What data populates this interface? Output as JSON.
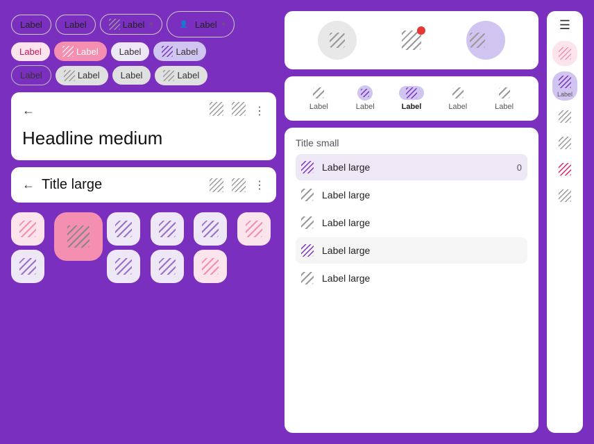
{
  "chips": {
    "row1": [
      {
        "label": "Label",
        "variant": "outlined"
      },
      {
        "label": "Label",
        "variant": "outlined"
      },
      {
        "label": "Label",
        "variant": "outlined-hatch",
        "hasClose": true
      },
      {
        "label": "Label",
        "variant": "outlined-avatar",
        "hasClose": true
      }
    ],
    "row2": [
      {
        "label": "Label",
        "variant": "filled-pink-light"
      },
      {
        "label": "Label",
        "variant": "filled-pink",
        "hasHatch": true
      },
      {
        "label": "Label",
        "variant": "filled-purple-light"
      },
      {
        "label": "Label",
        "variant": "filled-purple",
        "hasHatch": true
      }
    ],
    "row3": [
      {
        "label": "Label",
        "variant": "outlined-gray"
      },
      {
        "label": "Label",
        "variant": "filled-gray",
        "hasHatch": true
      },
      {
        "label": "Label",
        "variant": "filled-gray"
      },
      {
        "label": "Label",
        "variant": "filled-gray",
        "hasHatch": true
      }
    ]
  },
  "headline": {
    "text": "Headline medium"
  },
  "title_large": {
    "text": "Title large"
  },
  "top_icons": [
    {
      "type": "hatch",
      "bg": "gray"
    },
    {
      "type": "hatch-badge",
      "bg": "none"
    },
    {
      "type": "hatch",
      "bg": "gray-half"
    }
  ],
  "tab_bar": {
    "items": [
      {
        "label": "Label",
        "active": false
      },
      {
        "label": "Label",
        "active": false
      },
      {
        "label": "Label",
        "active": true
      },
      {
        "label": "Label",
        "active": false
      },
      {
        "label": "Label",
        "active": false
      }
    ]
  },
  "list": {
    "title": "Title small",
    "items": [
      {
        "label": "Label large",
        "active": true,
        "count": "0"
      },
      {
        "label": "Label large",
        "active": false
      },
      {
        "label": "Label large",
        "active": false
      },
      {
        "label": "Label large",
        "active": false,
        "variant": "gray"
      },
      {
        "label": "Label large",
        "active": false
      }
    ]
  },
  "rail": {
    "items": [
      {
        "label": "",
        "type": "menu"
      },
      {
        "label": "",
        "type": "pink-bg"
      },
      {
        "label": "Label",
        "type": "active"
      },
      {
        "label": "",
        "type": "gray"
      },
      {
        "label": "",
        "type": "gray"
      },
      {
        "label": "",
        "type": "pink"
      },
      {
        "label": "",
        "type": "gray"
      }
    ]
  }
}
